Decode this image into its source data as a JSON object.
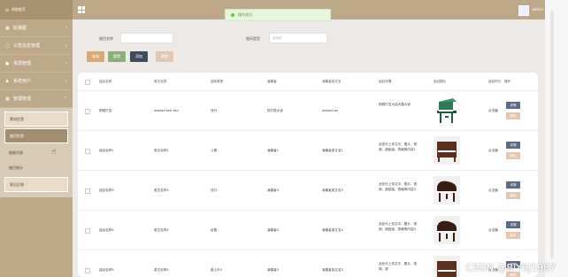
{
  "sidebar": {
    "brand": "系统首页",
    "menus": [
      {
        "icon": "▦",
        "label": "轮播图",
        "chev": "›"
      },
      {
        "icon": "▢",
        "label": "公告信息管理",
        "chev": "›"
      },
      {
        "icon": "●",
        "label": "资源管理",
        "chev": "›"
      },
      {
        "icon": "♟",
        "label": "系统用户",
        "chev": "›"
      },
      {
        "icon": "▦",
        "label": "管理管理",
        "chev": "⌃"
      }
    ],
    "submenu": [
      {
        "label": "素材信息",
        "style": "boxed"
      },
      {
        "label": "曲目信息",
        "style": "active"
      },
      {
        "label": "借曲列表",
        "style": "plain"
      },
      {
        "label": "曲目统计",
        "style": "plain"
      },
      {
        "label": "意见反馈",
        "style": "boxed"
      }
    ]
  },
  "topbar": {
    "admin": "admin"
  },
  "toast": {
    "text": "操作成功"
  },
  "search": {
    "name_label": "曲目名称",
    "type_label": "曲风类型",
    "type_placeholder": "请选择",
    "buttons": [
      {
        "label": "查询",
        "color": "#d9a877"
      },
      {
        "label": "重置",
        "color": "#8ab078"
      },
      {
        "label": "添加",
        "color": "#3f4a63"
      },
      {
        "label": "删除",
        "color": "#e3c9b3"
      }
    ]
  },
  "table": {
    "headers": [
      "曲目名称",
      "英文名称",
      "曲风类型",
      "演奏者",
      "演奏者英文名",
      "曲目详情",
      "曲目图片",
      "曲目时长",
      "操作"
    ],
    "rows": [
      {
        "name": "刚刚打发",
        "en": "asdasd asd asd",
        "type": "流行",
        "player": "阿打算大钟",
        "player_en": "asdasd as",
        "desc": "刚刚打发大姑大姨大钟",
        "time": "点击播",
        "piano": "green"
      },
      {
        "name": "曲目名称1",
        "en": "英文名称1",
        "type": "儿歌",
        "player": "演奏者1",
        "player_en": "演奏者英文名1",
        "desc": "此处可上传文字、图片、视频、超链接、表格等内容1",
        "time": "点击播",
        "piano": "upright"
      },
      {
        "name": "曲目名称3",
        "en": "英文名称3",
        "type": "流行",
        "player": "演奏者3",
        "player_en": "演奏者英文名3",
        "desc": "此处可上传文字、图片、视频、超链接、表格等内容3",
        "time": "点击播",
        "piano": "grand"
      },
      {
        "name": "曲目名称4",
        "en": "英文名称4",
        "type": "民歌",
        "player": "演奏者4",
        "player_en": "演奏者英文名4",
        "desc": "此处可上传文字、图片、视频、超链接、表格等内容4",
        "time": "点击播",
        "piano": "grand"
      },
      {
        "name": "曲目名称5",
        "en": "英文名称5",
        "type": "爵士乐5",
        "player": "演奏者5",
        "player_en": "演奏者英文名5",
        "desc": "此处可上传文字、图片、视频、超",
        "time": "点击播",
        "piano": "upright"
      }
    ],
    "op_detail": "详情",
    "op_delete": "删除"
  },
  "watermark": "CSDN @BiYSJ1987",
  "colors": {
    "sidebar": "#bda98a",
    "accent": "#a48e70",
    "detail_btn": "#5b6b83",
    "delete_btn": "#e3c9b3"
  }
}
